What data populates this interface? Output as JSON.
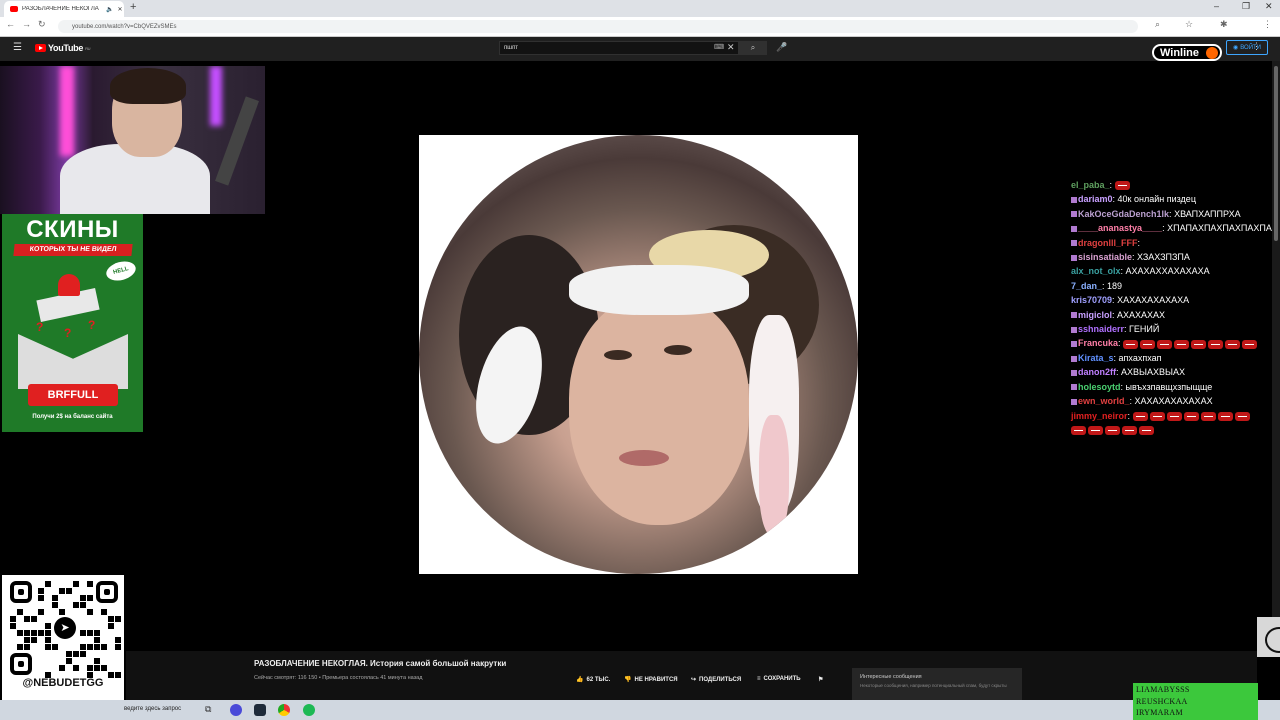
{
  "browser": {
    "tab_title": "РАЗОБЛАЧЕНИЕ НЕКОГЛА",
    "new_tab": "+",
    "url": "youtube.com/watch?v=CbQVEZvSMEs"
  },
  "youtube": {
    "logo_text": "YouTube",
    "logo_region": "RU",
    "search_value": "пшпт",
    "signin_label": "ВОЙТИ",
    "video": {
      "title": "РАЗОБЛАЧЕНИЕ НЕКОГЛАЯ. История самой большой накрутки",
      "meta": "Сейчас смотрят: 116 150 • Премьера состоялась 41 минута назад",
      "likes": "62 ТЫС.",
      "dislike": "НЕ НРАВИТСЯ",
      "share": "ПОДЕЛИТЬСЯ",
      "save": "СОХРАНИТЬ"
    },
    "interesting": {
      "title": "Интересные сообщения",
      "subtitle": "Некоторые сообщения, например потенциальный спам, будут скрыты"
    }
  },
  "overlay": {
    "sponsor": "Winline",
    "ad": {
      "headline": "СКИНЫ",
      "subline": "КОТОРЫХ ТЫ НЕ ВИДЕЛ",
      "brand": "HELL",
      "promo_code": "BRFFULL",
      "footer": "Получи 2$ на баланс сайта"
    },
    "qr_label": "@NEBUDETGG"
  },
  "chat": [
    {
      "nick": "el_paba_",
      "nick_color": "#5fa05f",
      "text": "",
      "emotes": 1,
      "badge": false
    },
    {
      "nick": "dariam0",
      "nick_color": "#c8a0ff",
      "text": "40к онлайн пиздец",
      "emotes": 0,
      "badge": true
    },
    {
      "nick": "KakOceGdaDench1lk",
      "nick_color": "#bba0d0",
      "text": "ХВАПХАППРХА",
      "emotes": 0,
      "badge": true
    },
    {
      "nick": "____ananastya____",
      "nick_color": "#ff7fa8",
      "text": "ХПАПАХПАХПАХПАХПАХПАХПА",
      "emotes": 0,
      "badge": true
    },
    {
      "nick": "dragonlll_FFF",
      "nick_color": "#e04040",
      "text": "",
      "emotes": 0,
      "badge": true
    },
    {
      "nick": "sisinsatiable",
      "nick_color": "#d8a0d0",
      "text": "ХЗАХЗПЗПА",
      "emotes": 0,
      "badge": true
    },
    {
      "nick": "alx_not_olx",
      "nick_color": "#3aa0a0",
      "text": "АХАХАХХАХАХАХА",
      "emotes": 0,
      "badge": false
    },
    {
      "nick": "7_dan_",
      "nick_color": "#8ab0ff",
      "text": "189",
      "emotes": 0,
      "badge": false
    },
    {
      "nick": "kris70709",
      "nick_color": "#a0a0ff",
      "text": "ХАХАХАХАХАХА",
      "emotes": 0,
      "badge": false
    },
    {
      "nick": "migiclol",
      "nick_color": "#c8a0ff",
      "text": "АХАХАХАХ",
      "emotes": 0,
      "badge": true
    },
    {
      "nick": "sshnaiderr",
      "nick_color": "#b070ff",
      "text": "ГЕНИЙ",
      "emotes": 0,
      "badge": true
    },
    {
      "nick": "Francuka",
      "nick_color": "#ff7fa8",
      "text": "",
      "emotes": 8,
      "badge": true
    },
    {
      "nick": "Kirata_s",
      "nick_color": "#6090ff",
      "text": "апхахпхап",
      "emotes": 0,
      "badge": true
    },
    {
      "nick": "danon2ff",
      "nick_color": "#c080ff",
      "text": "АХВЫАХВЫАХ",
      "emotes": 0,
      "badge": true
    },
    {
      "nick": "holesoytd",
      "nick_color": "#4ad070",
      "text": "ывъхзпавщхзпыщще",
      "emotes": 0,
      "badge": true
    },
    {
      "nick": "ewn_world_",
      "nick_color": "#e04040",
      "text": "ХАХАХАХАХАХАХ",
      "emotes": 0,
      "badge": true
    },
    {
      "nick": "jimmy_neiror",
      "nick_color": "#e02020",
      "text": "",
      "emotes": 12,
      "badge": false
    }
  ],
  "taskbar": {
    "search_placeholder": "ведите здесь запрос"
  },
  "tray_names": [
    "LIAMABYSSS",
    "REUSHCKAA",
    "IRYMARAM"
  ],
  "colors": {
    "youtube_red": "#ff0000",
    "winline_orange": "#ff6600",
    "ad_green": "#1f7a28",
    "promo_red": "#e02020",
    "tray_green": "#3cc83c"
  }
}
